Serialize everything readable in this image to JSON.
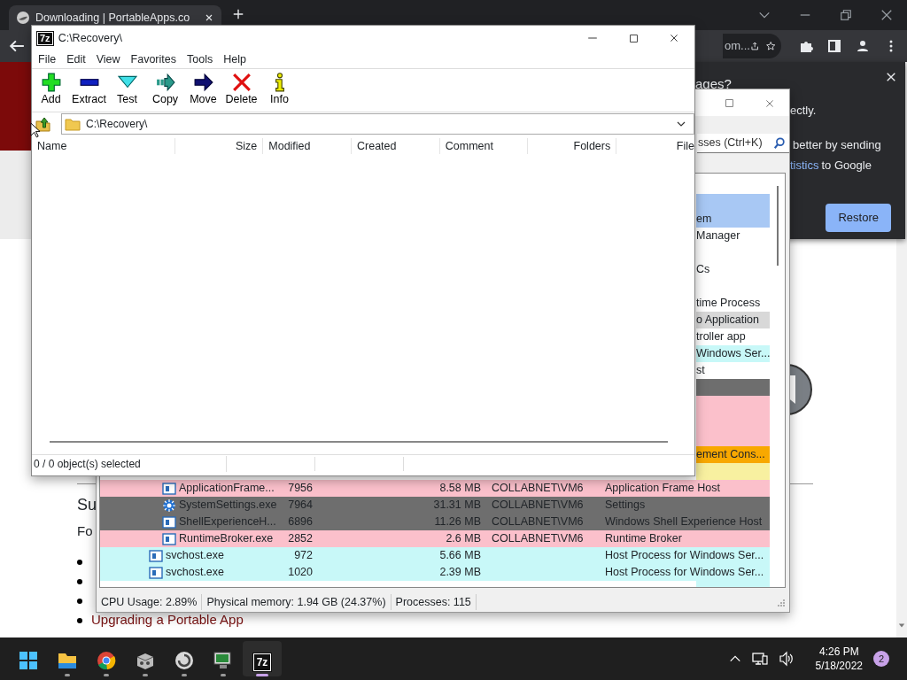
{
  "browser": {
    "tab_title": "Downloading | PortableApps.co",
    "address_fragment": "om...",
    "popup": {
      "heading_fragment": "ages?",
      "line_1": "ectly.",
      "line_2": "better by sending",
      "link": "tistics",
      "line_3": "to Google",
      "button": "Restore"
    },
    "page": {
      "heading_fragment": "Su",
      "text_fragment": "Fo",
      "list": [
        {
          "kind": "covered"
        },
        {
          "kind": "covered"
        },
        {
          "kind": "covered"
        },
        {
          "kind": "link",
          "text": "Upgrading a Portable App"
        }
      ]
    }
  },
  "process_window": {
    "search_placeholder": "sses (Ctrl+K)",
    "rows": [
      {
        "color": "#a8c8f4"
      },
      {
        "color": "#a8c8f4",
        "description": "em"
      },
      {
        "color": "#ffffff",
        "description": "Manager"
      },
      {
        "color": "#ffffff",
        "description": "Cs"
      },
      {
        "color": "#ffffff",
        "description": "time Process"
      },
      {
        "color": "#d8d8d8",
        "description": "o Application"
      },
      {
        "color": "#ffffff",
        "description": "troller app"
      },
      {
        "color": "#c8f8f8",
        "description": "Windows Ser..."
      },
      {
        "color": "#ffffff",
        "description": "st"
      },
      {
        "color": "#6e6e6e"
      },
      {
        "color": "#fbc0cb"
      },
      {
        "color": "#fbc0cb"
      },
      {
        "color": "#fbc0cb"
      },
      {
        "color": "#f8a800",
        "description": "ement Cons...",
        "children": [
          {
            "color": "#f8f0a0"
          },
          {
            "color": "#fbc0cb",
            "kind": "app",
            "name": "ApplicationFrame...",
            "pid": "7956",
            "memory": "8.58 MB",
            "user": "COLLABNET\\VM6",
            "description": "Application Frame Host"
          },
          {
            "color": "#6e6e6e",
            "kind": "settings",
            "name": "SystemSettings.exe",
            "pid": "7964",
            "memory": "31.31 MB",
            "user": "COLLABNET\\VM6",
            "description": "Settings"
          },
          {
            "color": "#6e6e6e",
            "kind": "app",
            "name": "ShellExperienceH...",
            "pid": "6896",
            "memory": "11.26 MB",
            "user": "COLLABNET\\VM6",
            "description": "Windows Shell Experience Host"
          },
          {
            "color": "#fbc0cb",
            "kind": "app",
            "name": "RuntimeBroker.exe",
            "pid": "2852",
            "memory": "2.6 MB",
            "user": "COLLABNET\\VM6",
            "description": "Runtime Broker"
          }
        ]
      },
      {
        "color": "#c8f8f8",
        "kind": "app",
        "name": "svchost.exe",
        "pid": "972",
        "memory": "5.66 MB",
        "description": "Host Process for Windows Ser..."
      },
      {
        "color": "#c8f8f8",
        "kind": "app",
        "name": "svchost.exe",
        "pid": "1020",
        "memory": "2.39 MB",
        "description": "Host Process for Windows Ser..."
      },
      {
        "color": "#c8f8f8"
      }
    ],
    "status": [
      "CPU Usage: 2.89%",
      "Physical memory: 1.94 GB (24.37%)",
      "Processes: 115"
    ]
  },
  "archive_window": {
    "logo": "7z",
    "title": "C:\\Recovery\\",
    "menu": [
      "File",
      "Edit",
      "View",
      "Favorites",
      "Tools",
      "Help"
    ],
    "toolbar": [
      {
        "kind": "add",
        "label": "Add"
      },
      {
        "kind": "extract",
        "label": "Extract"
      },
      {
        "kind": "test",
        "label": "Test"
      },
      {
        "kind": "copy",
        "label": "Copy"
      },
      {
        "kind": "move",
        "label": "Move"
      },
      {
        "kind": "delete",
        "label": "Delete"
      },
      {
        "kind": "info",
        "label": "Info"
      }
    ],
    "path": "C:\\Recovery\\",
    "columns": [
      "Name",
      "Size",
      "Modified",
      "Created",
      "Comment",
      "Folders",
      "File"
    ],
    "status": "0 / 0 object(s) selected"
  },
  "taskbar": {
    "apps": [
      {
        "kind": "start",
        "running": false,
        "selected": false
      },
      {
        "kind": "folder",
        "running": true,
        "selected": false
      },
      {
        "kind": "browser",
        "running": true,
        "selected": false
      },
      {
        "kind": "package",
        "running": true,
        "selected": false
      },
      {
        "kind": "disc",
        "running": true,
        "selected": false
      },
      {
        "kind": "monitor",
        "running": true,
        "selected": false
      },
      {
        "kind": "archiver",
        "label": "7z",
        "running": true,
        "selected": true
      }
    ],
    "time": "4:26 PM",
    "date": "5/18/2022",
    "notifications": "2"
  }
}
